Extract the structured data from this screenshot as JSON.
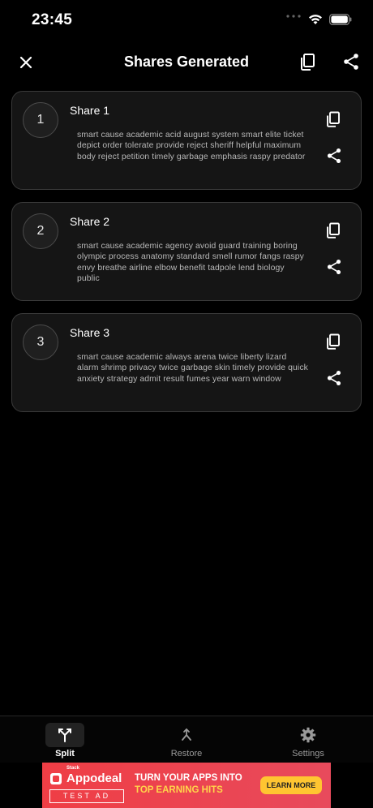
{
  "status_bar": {
    "time": "23:45"
  },
  "nav": {
    "title": "Shares Generated"
  },
  "shares": [
    {
      "number": "1",
      "title": "Share 1",
      "words": "smart cause academic acid august system smart elite ticket depict order tolerate provide reject sheriff helpful maximum body reject petition timely garbage emphasis raspy predator"
    },
    {
      "number": "2",
      "title": "Share 2",
      "words": "smart cause academic agency avoid guard training boring olympic process anatomy standard smell rumor fangs raspy envy breathe airline elbow benefit tadpole lend biology public"
    },
    {
      "number": "3",
      "title": "Share 3",
      "words": "smart cause academic always arena twice liberty lizard alarm shrimp privacy twice garbage skin timely provide quick anxiety strategy admit result fumes year warn window"
    }
  ],
  "tabs": [
    {
      "label": "Split",
      "icon": "split-icon",
      "active": true
    },
    {
      "label": "Restore",
      "icon": "merge-icon",
      "active": false
    },
    {
      "label": "Settings",
      "icon": "gear-icon",
      "active": false
    }
  ],
  "ad": {
    "brand_small": "Stack",
    "brand": "Appodeal",
    "badge": "TEST AD",
    "headline_1": "TURN YOUR APPS INTO",
    "headline_2": "TOP EARNING HITS",
    "cta": "LEARN MORE"
  },
  "colors": {
    "background": "#000000",
    "card": "#151515",
    "ad_red": "#ef3e45",
    "ad_yellow": "#ffd54a"
  }
}
